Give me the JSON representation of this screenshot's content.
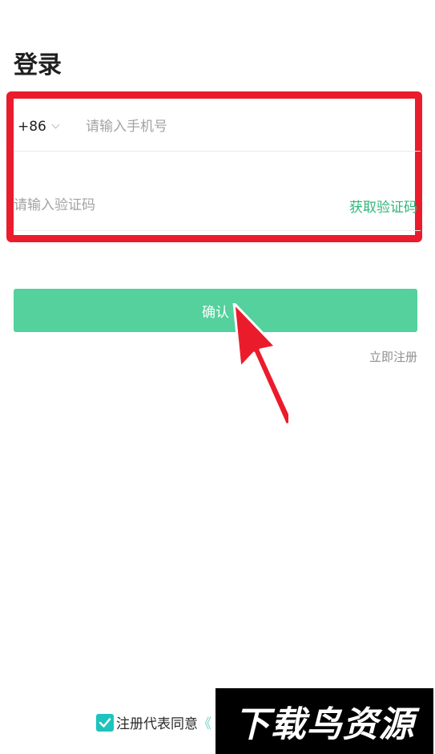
{
  "page": {
    "title": "登录"
  },
  "form": {
    "country_code": "+86",
    "phone_placeholder": "请输入手机号",
    "code_placeholder": "请输入验证码",
    "get_code_label": "获取验证码",
    "confirm_label": "确认",
    "register_label": "立即注册"
  },
  "agreement": {
    "checked": true,
    "text": "注册代表同意",
    "link_text": "《"
  },
  "watermark": {
    "text": "下载鸟资源"
  },
  "colors": {
    "accent": "#54d19c",
    "link_green": "#31b57b",
    "highlight_red": "#ea1c2c",
    "checkbox": "#1dc4bd"
  }
}
